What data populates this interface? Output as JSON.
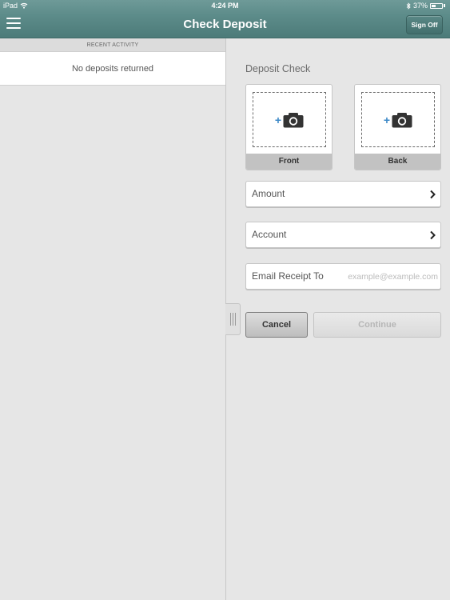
{
  "status_bar": {
    "device": "iPad",
    "time": "4:24 PM",
    "battery": "37%",
    "battery_level": 0.37
  },
  "nav": {
    "title": "Check Deposit",
    "sign_off_label": "Sign Off",
    "menu_icon": "hamburger-icon"
  },
  "recent_activity": {
    "header": "RECENT ACTIVITY",
    "empty_message": "No deposits returned"
  },
  "deposit": {
    "title": "Deposit Check",
    "front_label": "Front",
    "back_label": "Back",
    "camera_icon": "camera-icon",
    "amount_label": "Amount",
    "account_label": "Account",
    "email_label": "Email Receipt To",
    "email_placeholder": "example@example.com",
    "email_value": "",
    "cancel_label": "Cancel",
    "continue_label": "Continue"
  },
  "colors": {
    "header": "#5d8c8a",
    "accent_plus": "#3b88c7",
    "background": "#e6e6e6"
  }
}
